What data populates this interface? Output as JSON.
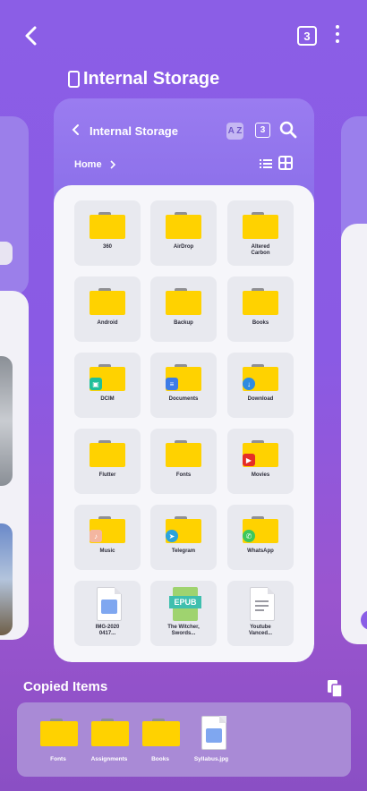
{
  "header": {
    "back_icon": "chevron-left-icon",
    "tab_count": "3",
    "menu_icon": "more-vertical-icon"
  },
  "page_title": "Internal Storage",
  "card": {
    "title": "Internal Storage",
    "tab_count": "3",
    "sort_label": "A Z",
    "breadcrumb": "Home",
    "items": [
      {
        "label": "360",
        "type": "folder"
      },
      {
        "label": "AirDrop",
        "type": "folder"
      },
      {
        "label": "Altered\nCarbon",
        "type": "folder"
      },
      {
        "label": "Android",
        "type": "folder"
      },
      {
        "label": "Backup",
        "type": "folder"
      },
      {
        "label": "Books",
        "type": "folder"
      },
      {
        "label": "DCIM",
        "type": "folder",
        "badge": "gallery-icon",
        "badge_color": "#1fbf9a"
      },
      {
        "label": "Documents",
        "type": "folder",
        "badge": "document-icon",
        "badge_color": "#3d7be6"
      },
      {
        "label": "Download",
        "type": "folder",
        "badge": "download-icon",
        "badge_color": "#2f8be0"
      },
      {
        "label": "Flutter",
        "type": "folder"
      },
      {
        "label": "Fonts",
        "type": "folder"
      },
      {
        "label": "Movies",
        "type": "folder",
        "badge": "youtube-icon",
        "badge_color": "#e52d27"
      },
      {
        "label": "Music",
        "type": "folder",
        "badge": "music-note-icon",
        "badge_color": "#f4b6a0"
      },
      {
        "label": "Telegram",
        "type": "folder",
        "badge": "telegram-icon",
        "badge_color": "#2aa3dd"
      },
      {
        "label": "WhatsApp",
        "type": "folder",
        "badge": "whatsapp-icon",
        "badge_color": "#3dc75b"
      },
      {
        "label": "IMG-2020\n0417...",
        "type": "image"
      },
      {
        "label": "The Witcher,\nSwords...",
        "type": "epub",
        "badge_text": "EPUB"
      },
      {
        "label": "Youtube\nVanced...",
        "type": "doc"
      }
    ]
  },
  "copied": {
    "title": "Copied Items",
    "items": [
      {
        "label": "Fonts",
        "type": "folder"
      },
      {
        "label": "Assignments",
        "type": "folder"
      },
      {
        "label": "Books",
        "type": "folder"
      },
      {
        "label": "Syllabus.jpg",
        "type": "image"
      }
    ]
  },
  "colors": {
    "accent": "#8c70ea",
    "folder": "#ffd200"
  }
}
